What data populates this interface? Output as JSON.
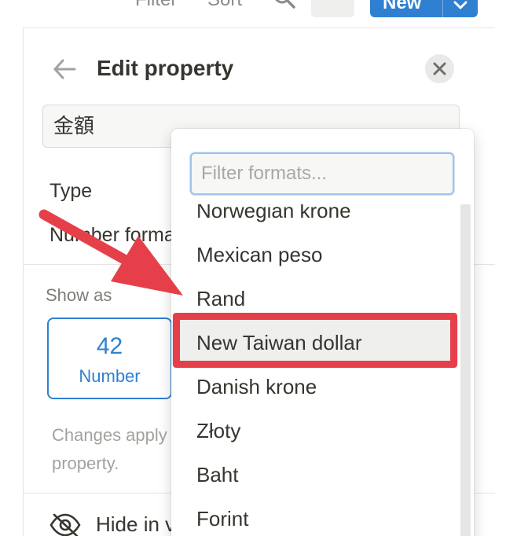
{
  "toolbar": {
    "filter_label": "Filter",
    "sort_label": "Sort",
    "search_icon": "search-icon",
    "new_label": "New",
    "new_caret_icon": "chevron-down-icon"
  },
  "panel": {
    "back_icon": "arrow-left-icon",
    "title": "Edit property",
    "close_icon": "close-icon",
    "name_value": "金額",
    "type_label": "Type",
    "number_format_label": "Number format",
    "show_as_label": "Show as",
    "show_as_card": {
      "value": "42",
      "label": "Number"
    },
    "helper_text_line1": "Changes apply to",
    "helper_text_line2": "property.",
    "hide_icon": "eye-off-icon",
    "hide_label": "Hide in view"
  },
  "dropdown": {
    "filter_placeholder": "Filter formats...",
    "filter_value": "",
    "items": [
      {
        "label": "Norwegian krone",
        "highlighted": false
      },
      {
        "label": "Mexican peso",
        "highlighted": false
      },
      {
        "label": "Rand",
        "highlighted": false
      },
      {
        "label": "New Taiwan dollar",
        "highlighted": true
      },
      {
        "label": "Danish krone",
        "highlighted": false
      },
      {
        "label": "Złoty",
        "highlighted": false
      },
      {
        "label": "Baht",
        "highlighted": false
      },
      {
        "label": "Forint",
        "highlighted": false
      }
    ]
  },
  "colors": {
    "accent_blue": "#2f80d1",
    "annotation_red": "#e5404a",
    "text": "#37352f",
    "muted_text": "#a3a29e"
  }
}
